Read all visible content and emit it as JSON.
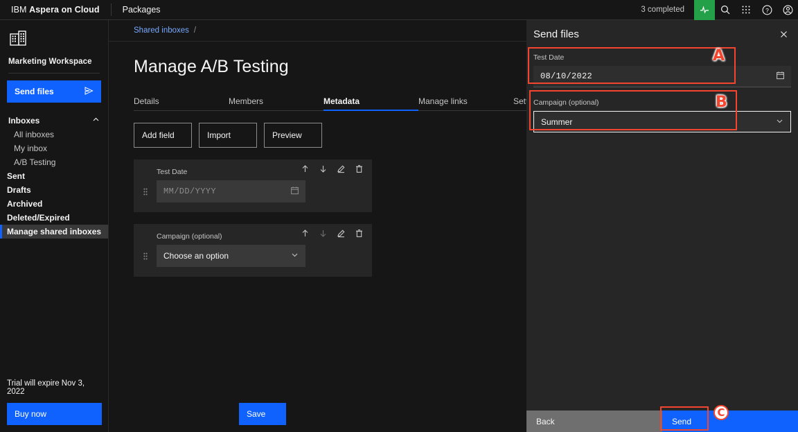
{
  "header": {
    "brand_prefix": "IBM ",
    "brand_name": "Aspera on Cloud",
    "nav_link": "Packages",
    "status": "3 completed",
    "icons": [
      "activity-icon",
      "search-icon",
      "app-switcher-icon",
      "help-icon",
      "account-icon"
    ]
  },
  "sidebar": {
    "workspace_name": "Marketing Workspace",
    "send_files_label": "Send files",
    "inboxes_group": "Inboxes",
    "sub_items": [
      {
        "label": "All inboxes"
      },
      {
        "label": "My inbox"
      },
      {
        "label": "A/B Testing"
      }
    ],
    "items": [
      {
        "label": "Sent",
        "active": false
      },
      {
        "label": "Drafts",
        "active": false
      },
      {
        "label": "Archived",
        "active": false
      },
      {
        "label": "Deleted/Expired",
        "active": false
      },
      {
        "label": "Manage shared inboxes",
        "active": true
      }
    ],
    "trial_text": "Trial will expire Nov 3, 2022",
    "buy_now_label": "Buy now"
  },
  "main": {
    "breadcrumb": {
      "link": "Shared inboxes",
      "separator": "/"
    },
    "page_title": "Manage A/B Testing",
    "tabs": [
      {
        "label": "Details",
        "active": false
      },
      {
        "label": "Members",
        "active": false
      },
      {
        "label": "Metadata",
        "active": true
      },
      {
        "label": "Manage links",
        "active": false
      },
      {
        "label": "Settings",
        "active": false
      }
    ],
    "action_buttons": [
      {
        "label": "Add field"
      },
      {
        "label": "Import"
      },
      {
        "label": "Preview"
      }
    ],
    "fields": [
      {
        "label": "Test Date",
        "value": "MM/DD/YYYY",
        "control": "date-input",
        "trailing_icon": "calendar-icon"
      },
      {
        "label": "Campaign (optional)",
        "value": "Choose an option",
        "control": "select",
        "trailing_icon": "chevron-down-icon"
      }
    ],
    "row_icons": [
      "move-up-icon",
      "move-down-icon",
      "edit-icon",
      "delete-icon"
    ],
    "save_label": "Save"
  },
  "panel": {
    "title": "Send files",
    "close_icon": "close-icon",
    "fields": [
      {
        "label": "Test Date",
        "value": "08/10/2022",
        "control": "date-input",
        "trailing_icon": "calendar-icon"
      },
      {
        "label": "Campaign (optional)",
        "value": "Summer",
        "control": "select",
        "trailing_icon": "chevron-down-icon"
      }
    ],
    "back_label": "Back",
    "send_label": "Send"
  },
  "annotations": [
    {
      "letter": "A",
      "target": "panel-test-date-field"
    },
    {
      "letter": "B",
      "target": "panel-campaign-field"
    },
    {
      "letter": "C",
      "target": "panel-send-button"
    }
  ],
  "colors": {
    "accent_blue": "#0f62fe",
    "link_blue": "#78a9ff",
    "annotation_red": "#f4452e",
    "activity_green": "#24a148",
    "panel_bg": "#262626",
    "app_bg": "#161616"
  }
}
